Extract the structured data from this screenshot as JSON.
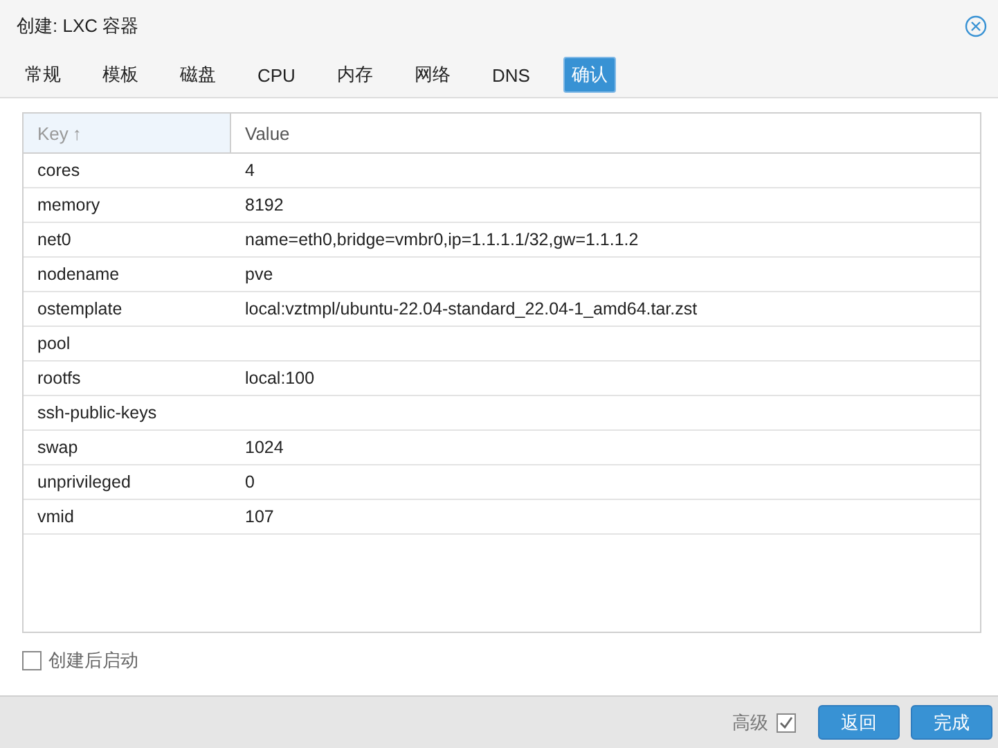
{
  "window": {
    "title": "创建: LXC 容器"
  },
  "tabs": [
    {
      "label": "常规",
      "selected": false
    },
    {
      "label": "模板",
      "selected": false
    },
    {
      "label": "磁盘",
      "selected": false
    },
    {
      "label": "CPU",
      "selected": false
    },
    {
      "label": "内存",
      "selected": false
    },
    {
      "label": "网络",
      "selected": false
    },
    {
      "label": "DNS",
      "selected": false
    },
    {
      "label": "确认",
      "selected": true
    }
  ],
  "table": {
    "columns": [
      {
        "label": "Key",
        "sort_icon": "↑"
      },
      {
        "label": "Value"
      }
    ],
    "rows": [
      {
        "key": "cores",
        "value": "4"
      },
      {
        "key": "memory",
        "value": "8192"
      },
      {
        "key": "net0",
        "value": "name=eth0,bridge=vmbr0,ip=1.1.1.1/32,gw=1.1.1.2"
      },
      {
        "key": "nodename",
        "value": "pve"
      },
      {
        "key": "ostemplate",
        "value": "local:vztmpl/ubuntu-22.04-standard_22.04-1_amd64.tar.zst"
      },
      {
        "key": "pool",
        "value": ""
      },
      {
        "key": "rootfs",
        "value": "local:100"
      },
      {
        "key": "ssh-public-keys",
        "value": ""
      },
      {
        "key": "swap",
        "value": "1024"
      },
      {
        "key": "unprivileged",
        "value": "0"
      },
      {
        "key": "vmid",
        "value": "107"
      }
    ]
  },
  "start_after_create": {
    "label": "创建后启动",
    "checked": false
  },
  "footer": {
    "advanced": {
      "label": "高级",
      "checked": true
    },
    "buttons": [
      "返回",
      "完成"
    ]
  }
}
